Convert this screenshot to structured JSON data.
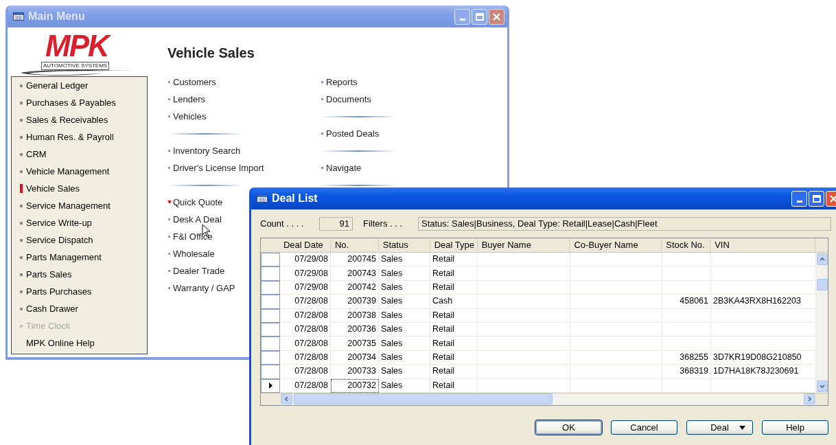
{
  "main_menu": {
    "title": "Main Menu",
    "active": false,
    "logo": {
      "mark": "MPK",
      "tagline": "AUTOMOTIVE SYSTEMS"
    },
    "sidebar": {
      "items": [
        {
          "label": "General Ledger",
          "kind": "module",
          "selected": false,
          "disabled": false
        },
        {
          "label": "Purchases & Payables",
          "kind": "module",
          "selected": false,
          "disabled": false
        },
        {
          "label": "Sales & Receivables",
          "kind": "module",
          "selected": false,
          "disabled": false
        },
        {
          "label": "Human Res. & Payroll",
          "kind": "module",
          "selected": false,
          "disabled": false
        },
        {
          "label": "CRM",
          "kind": "module",
          "selected": false,
          "disabled": false
        },
        {
          "label": "Vehicle Management",
          "kind": "module",
          "selected": false,
          "disabled": false
        },
        {
          "label": "Vehicle Sales",
          "kind": "module",
          "selected": true,
          "disabled": false
        },
        {
          "label": "Service Management",
          "kind": "module",
          "selected": false,
          "disabled": false
        },
        {
          "label": "Service Write-up",
          "kind": "module",
          "selected": false,
          "disabled": false
        },
        {
          "label": "Service Dispatch",
          "kind": "module",
          "selected": false,
          "disabled": false
        },
        {
          "label": "Parts Management",
          "kind": "module",
          "selected": false,
          "disabled": false
        },
        {
          "label": "Parts Sales",
          "kind": "module",
          "selected": false,
          "disabled": false
        },
        {
          "label": "Parts Purchases",
          "kind": "module",
          "selected": false,
          "disabled": false
        },
        {
          "label": "Cash Drawer",
          "kind": "module",
          "selected": false,
          "disabled": false
        },
        {
          "label": "Time Clock",
          "kind": "module",
          "selected": false,
          "disabled": true
        },
        {
          "label": "MPK Online Help",
          "kind": "link",
          "selected": false,
          "disabled": false
        }
      ]
    },
    "heading": "Vehicle Sales",
    "columns": [
      {
        "groups": [
          {
            "separator_after": true,
            "items": [
              {
                "label": "Customers",
                "expanded": false
              },
              {
                "label": "Lenders",
                "expanded": false
              },
              {
                "label": "Vehicles",
                "expanded": false
              }
            ]
          },
          {
            "separator_after": true,
            "items": [
              {
                "label": "Inventory Search",
                "expanded": false
              },
              {
                "label": "Driver's License Import",
                "expanded": false
              }
            ]
          },
          {
            "separator_after": false,
            "items": [
              {
                "label": "Quick Quote",
                "expanded": true
              },
              {
                "label": "Desk A Deal",
                "expanded": false
              },
              {
                "label": "F&I Office",
                "expanded": false
              },
              {
                "label": "Wholesale",
                "expanded": false
              },
              {
                "label": "Dealer Trade",
                "expanded": false
              },
              {
                "label": "Warranty / GAP",
                "expanded": false
              }
            ]
          }
        ]
      },
      {
        "groups": [
          {
            "separator_after": true,
            "items": [
              {
                "label": "Reports",
                "expanded": false
              },
              {
                "label": "Documents",
                "expanded": false
              }
            ]
          },
          {
            "separator_after": true,
            "items": [
              {
                "label": "Posted Deals",
                "expanded": false
              }
            ]
          },
          {
            "separator_after": true,
            "items": [
              {
                "label": "Navigate",
                "expanded": false
              }
            ]
          }
        ]
      }
    ]
  },
  "deal_list": {
    "title": "Deal List",
    "active": true,
    "count_label": "Count . . . .",
    "count": "91",
    "filters_label": "Filters . . .",
    "filters": "Status: Sales|Business, Deal Type: Retail|Lease|Cash|Fleet",
    "table": {
      "columns": [
        "Deal Date",
        "No.",
        "Status",
        "Deal Type",
        "Buyer Name",
        "Co-Buyer Name",
        "Stock No.",
        "VIN"
      ],
      "rows": [
        {
          "selected": false,
          "deal_date": "07/29/08",
          "no": "200745",
          "status": "Sales",
          "deal_type": "Retail"
        },
        {
          "selected": false,
          "deal_date": "07/29/08",
          "no": "200743",
          "status": "Sales",
          "deal_type": "Retail"
        },
        {
          "selected": false,
          "deal_date": "07/29/08",
          "no": "200742",
          "status": "Sales",
          "deal_type": "Retail"
        },
        {
          "selected": false,
          "deal_date": "07/28/08",
          "no": "200739",
          "status": "Sales",
          "deal_type": "Cash",
          "stock_no": "458061",
          "vin": "2B3KA43RX8H162203"
        },
        {
          "selected": false,
          "deal_date": "07/28/08",
          "no": "200738",
          "status": "Sales",
          "deal_type": "Retail"
        },
        {
          "selected": false,
          "deal_date": "07/28/08",
          "no": "200736",
          "status": "Sales",
          "deal_type": "Retail"
        },
        {
          "selected": false,
          "deal_date": "07/28/08",
          "no": "200735",
          "status": "Sales",
          "deal_type": "Retail"
        },
        {
          "selected": false,
          "deal_date": "07/28/08",
          "no": "200734",
          "status": "Sales",
          "deal_type": "Retail",
          "stock_no": "368255",
          "vin": "3D7KR19D08G210850"
        },
        {
          "selected": false,
          "deal_date": "07/28/08",
          "no": "200733",
          "status": "Sales",
          "deal_type": "Retail",
          "stock_no": "368319",
          "vin": "1D7HA18K78J230691"
        },
        {
          "selected": true,
          "deal_date": "07/28/08",
          "no": "200732",
          "status": "Sales",
          "deal_type": "Retail"
        }
      ]
    },
    "buttons": [
      {
        "label": "OK",
        "kind": "plain",
        "default": true
      },
      {
        "label": "Cancel",
        "kind": "plain",
        "default": false
      },
      {
        "label": "Deal",
        "kind": "menu",
        "default": false
      },
      {
        "label": "Help",
        "kind": "plain",
        "default": false
      }
    ]
  }
}
